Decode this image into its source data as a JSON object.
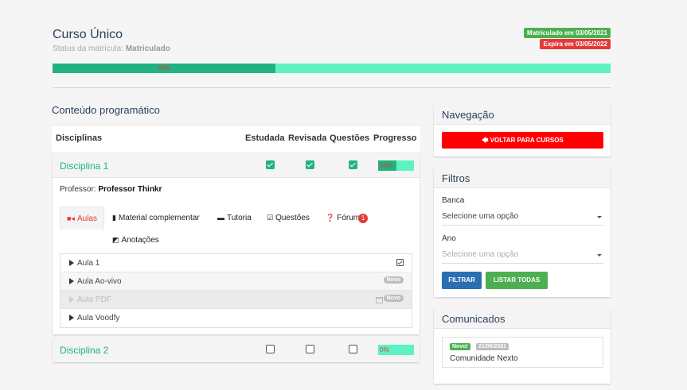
{
  "header": {
    "title": "Curso Único",
    "status_label": "Status da matrícula:",
    "status_value": "Matriculado",
    "enrolled_badge": "Matriculado em 03/05/2021",
    "expires_badge": "Expira em 03/05/2022"
  },
  "progress": {
    "value": 40,
    "label": "40%"
  },
  "content": {
    "title": "Conteúdo programático",
    "columns": [
      "Disciplinas",
      "Estudada",
      "Revisada",
      "Questões",
      "Progresso"
    ]
  },
  "disciplines": [
    {
      "name": "Disciplina 1",
      "studied": true,
      "reviewed": true,
      "questions": true,
      "progress": 50,
      "progress_label": "50%",
      "professor_label": "Professor:",
      "professor_name": "Professor Thinkr",
      "tabs": [
        {
          "label": "Aulas",
          "icon": "video-icon",
          "active": true
        },
        {
          "label": "Material complementar",
          "icon": "book-icon"
        },
        {
          "label": "Tutoria",
          "icon": "comment-icon"
        },
        {
          "label": "Questões",
          "icon": "check-square-icon"
        },
        {
          "label": "Fórum",
          "icon": "question-circle-icon",
          "count": "1"
        },
        {
          "label": "Anotações",
          "icon": "edit-icon"
        }
      ],
      "lessons": [
        {
          "name": "Aula 1",
          "tag": "",
          "done": true,
          "disabled": false
        },
        {
          "name": "Aula Ao-vivo",
          "tag": "Novo",
          "done": false,
          "disabled": false
        },
        {
          "name": "Aula PDF",
          "tag": "Novo",
          "done": false,
          "disabled": true
        },
        {
          "name": "Aula Voodfy",
          "tag": "",
          "done": false,
          "disabled": false
        }
      ]
    },
    {
      "name": "Disciplina 2",
      "studied": false,
      "reviewed": false,
      "questions": false,
      "progress": 0,
      "progress_label": "0%"
    }
  ],
  "navigation": {
    "title": "Navegação",
    "back_button": "VOLTAR PARA CURSOS"
  },
  "filters": {
    "title": "Filtros",
    "banca_label": "Banca",
    "banca_value": "Selecione uma opção",
    "ano_label": "Ano",
    "ano_placeholder": "Selecione uma opção",
    "filter_button": "FILTRAR",
    "list_all_button": "LISTAR TODAS"
  },
  "announcements": {
    "title": "Comunicados",
    "items": [
      {
        "tag": "Novo!",
        "date": "21/06/2021",
        "text": "Comunidade Nexto"
      }
    ]
  },
  "colors": {
    "accent": "#1fb380",
    "accent_light": "#5ef2c1",
    "danger": "#e53935",
    "primary": "#2b6fb3"
  }
}
